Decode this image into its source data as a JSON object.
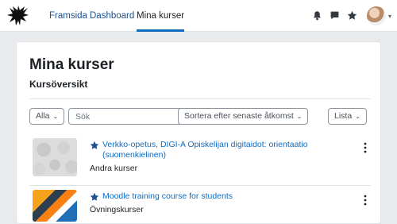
{
  "nav": {
    "links": [
      {
        "label": "Framsida"
      },
      {
        "label": "Dashboard"
      },
      {
        "label": "Mina kurser"
      }
    ],
    "icons": [
      "bell-icon",
      "chat-icon",
      "star-icon"
    ]
  },
  "page": {
    "title": "Mina kurser",
    "section_title": "Kursöversikt"
  },
  "filters": {
    "grouping": "Alla",
    "search_placeholder": "Sök",
    "sort": "Sortera efter senaste åtkomst",
    "view": "Lista"
  },
  "courses": [
    {
      "title": "Verkko-opetus, DIGI-A Opiskelijan digitaidot: orientaatio (suomenkielinen)",
      "category": "Andra kurser",
      "starred": true
    },
    {
      "title": "Moodle training course for students",
      "category": "Övningskurser",
      "starred": true
    }
  ],
  "colors": {
    "accent": "#0f6cbf",
    "background": "#e8eaec"
  }
}
